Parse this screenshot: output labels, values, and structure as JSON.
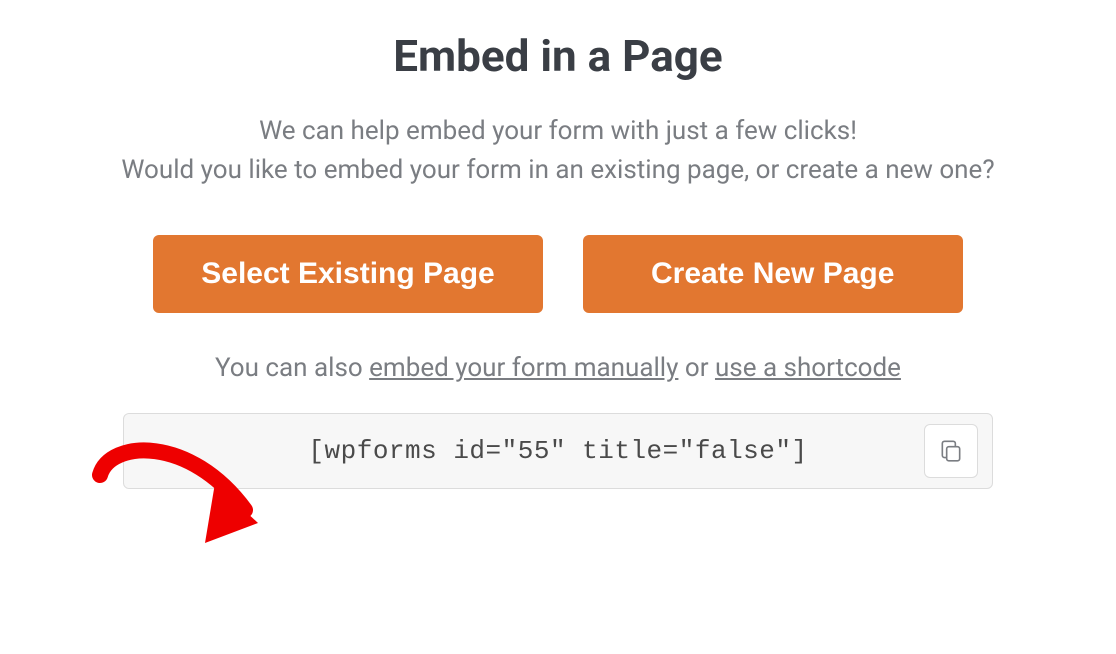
{
  "title": "Embed in a Page",
  "description_line1": "We can help embed your form with just a few clicks!",
  "description_line2": "Would you like to embed your form in an existing page, or create a new one?",
  "buttons": {
    "select_existing": "Select Existing Page",
    "create_new": "Create New Page"
  },
  "alt": {
    "prefix": "You can also ",
    "link_manual": "embed your form manually",
    "middle": " or ",
    "link_shortcode": "use a shortcode"
  },
  "shortcode": "[wpforms id=\"55\" title=\"false\"]",
  "colors": {
    "accent": "#e27730",
    "text_dark": "#3a3e45",
    "text_muted": "#7a7d82",
    "annotation": "#ee0000"
  }
}
